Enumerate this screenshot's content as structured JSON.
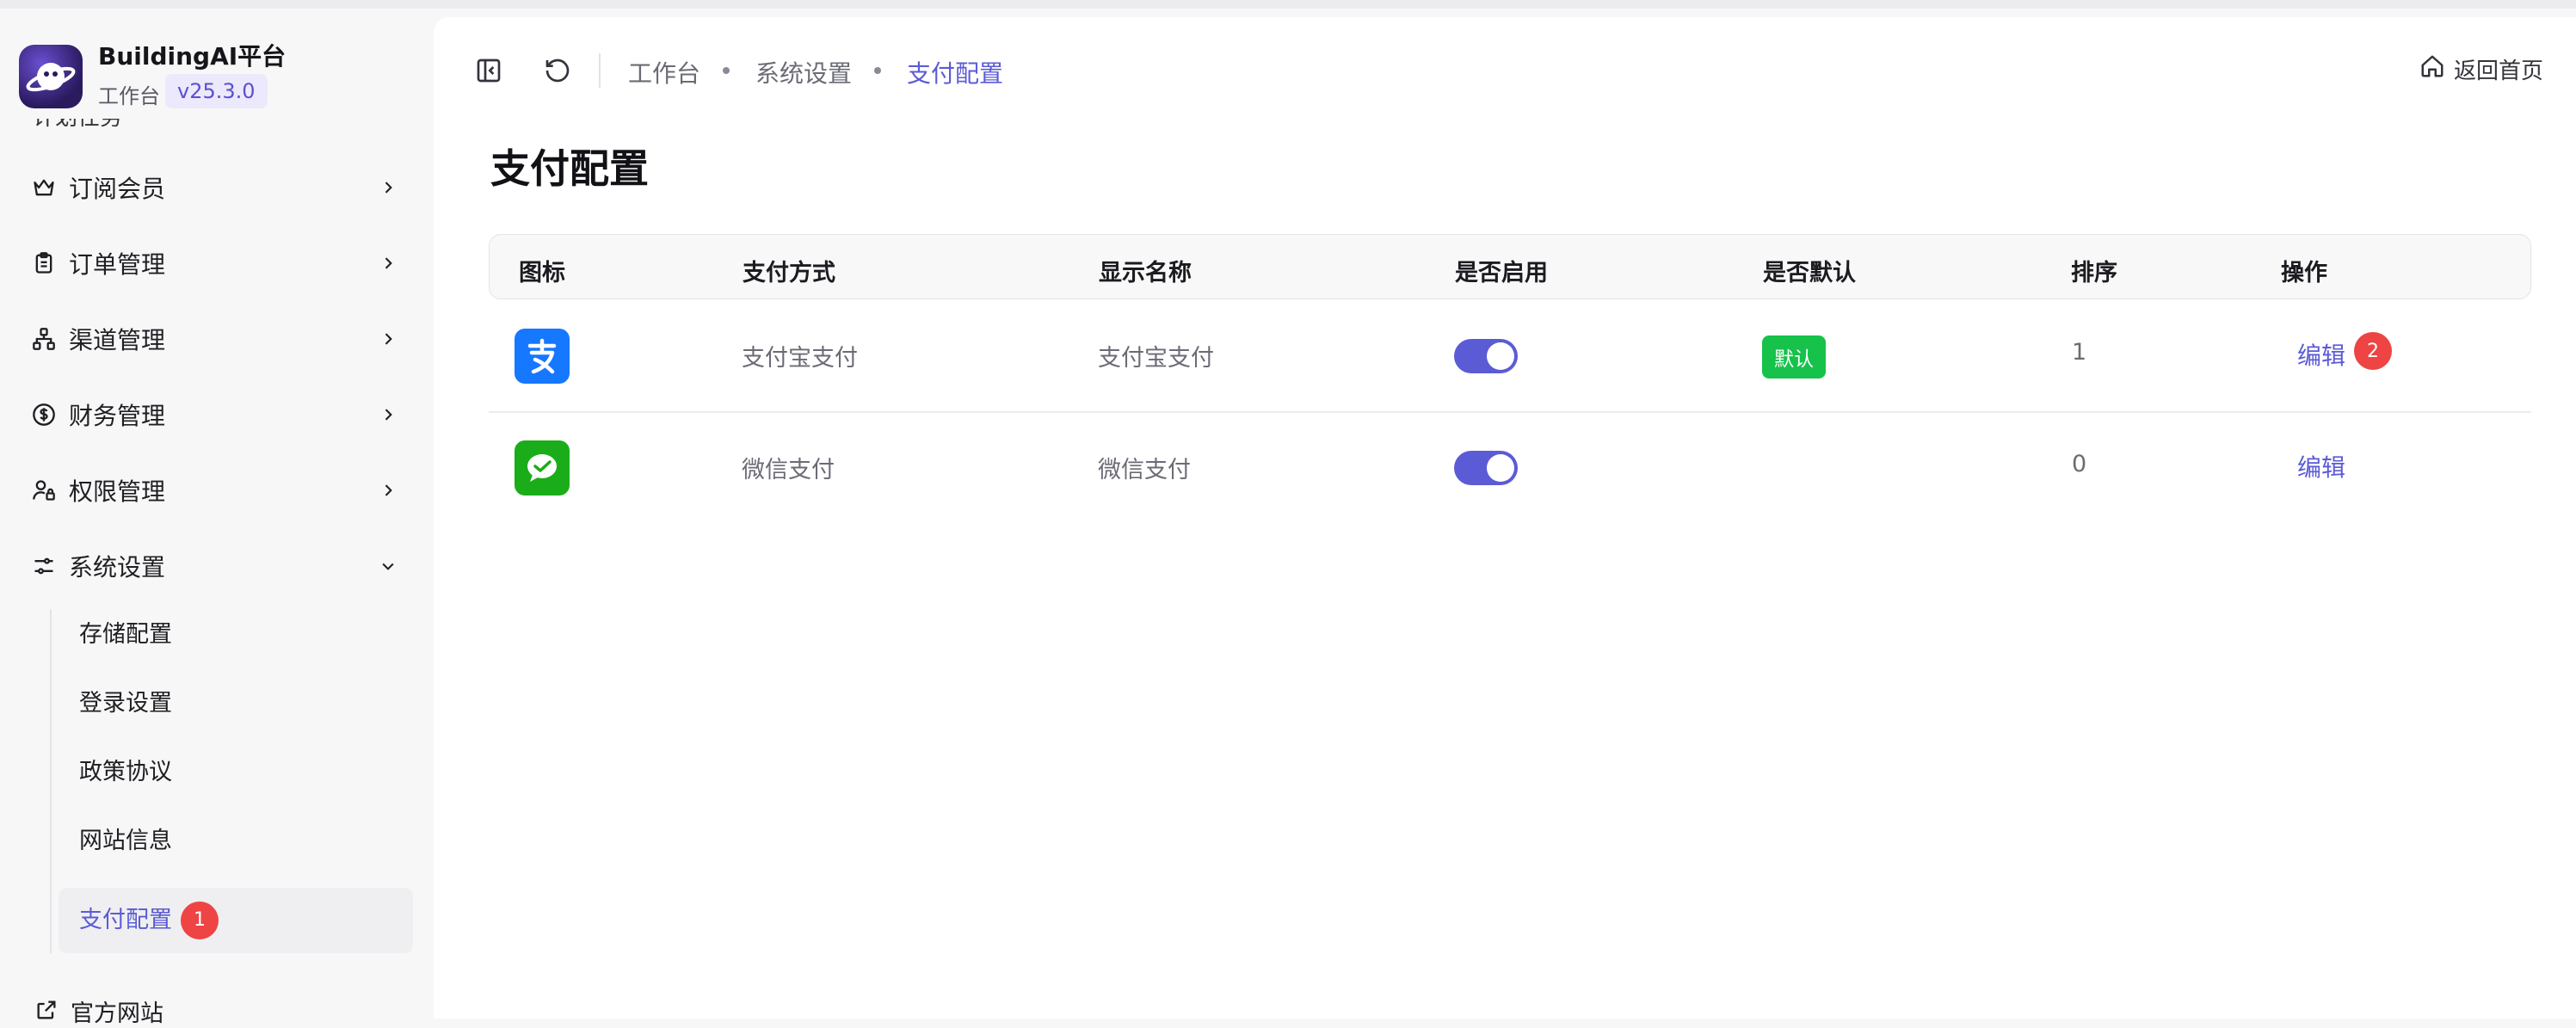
{
  "brand": {
    "name": "BuildingAI平台",
    "subtitle": "工作台",
    "version": "v25.3.0"
  },
  "sidebar": {
    "clipped_item": "计划任务",
    "items": [
      {
        "label": "订阅会员",
        "icon": "crown-icon"
      },
      {
        "label": "订单管理",
        "icon": "clipboard-icon"
      },
      {
        "label": "渠道管理",
        "icon": "network-icon"
      },
      {
        "label": "财务管理",
        "icon": "dollar-circle-icon"
      },
      {
        "label": "权限管理",
        "icon": "user-lock-icon"
      },
      {
        "label": "系统设置",
        "icon": "sliders-icon"
      }
    ],
    "sub_items": [
      "存储配置",
      "登录设置",
      "政策协议",
      "网站信息",
      "支付配置"
    ],
    "active_sub_badge": "1",
    "external": "官方网站"
  },
  "header": {
    "breadcrumb": [
      "工作台",
      "系统设置",
      "支付配置"
    ],
    "home_link": "返回首页"
  },
  "page": {
    "title": "支付配置"
  },
  "table": {
    "columns": [
      "图标",
      "支付方式",
      "显示名称",
      "是否启用",
      "是否默认",
      "排序",
      "操作"
    ],
    "rows": [
      {
        "icon": "alipay-icon",
        "method": "支付宝支付",
        "display": "支付宝支付",
        "enabled": true,
        "default_label": "默认",
        "sort": "1",
        "action": "编辑",
        "badge": "2"
      },
      {
        "icon": "wechat-pay-icon",
        "method": "微信支付",
        "display": "微信支付",
        "enabled": true,
        "default_label": "",
        "sort": "0",
        "action": "编辑",
        "badge": ""
      }
    ]
  },
  "colors": {
    "accent": "#5b5bd6",
    "badge": "#ef4444",
    "default": "#16c24a",
    "alipay": "#1677ff",
    "wechat": "#1aad19"
  }
}
